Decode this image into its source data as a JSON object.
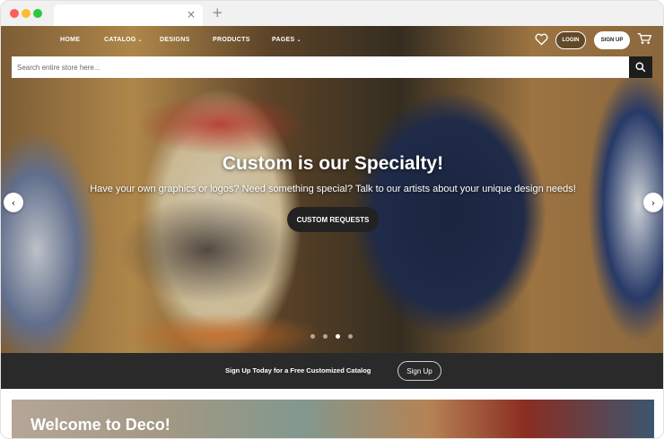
{
  "browser": {
    "tab_close": "×",
    "new_tab": "+"
  },
  "nav": {
    "items": [
      {
        "label": "HOME",
        "has_caret": false
      },
      {
        "label": "CATALOG",
        "has_caret": true
      },
      {
        "label": "DESIGNS",
        "has_caret": false
      },
      {
        "label": "PRODUCTS",
        "has_caret": false
      },
      {
        "label": "PAGES",
        "has_caret": true
      }
    ],
    "caret": "⌄",
    "login_label": "LOGIN",
    "signup_label": "SIGN UP",
    "icons": {
      "wishlist": "heart-icon",
      "cart": "cart-icon"
    }
  },
  "search": {
    "placeholder": "Search entire store here...",
    "value": ""
  },
  "hero": {
    "title": "Custom is our Specialty!",
    "subtitle": "Have your own graphics or logos? Need something special? Talk to our artists about your unique design needs!",
    "cta_label": "CUSTOM REQUESTS",
    "prev_glyph": "‹",
    "next_glyph": "›",
    "slide_count": 4,
    "active_slide": 3
  },
  "promo_band": {
    "text": "Sign Up Today for a Free Customized Catalog",
    "button_label": "Sign Up"
  },
  "welcome": {
    "title": "Welcome to Deco!"
  }
}
